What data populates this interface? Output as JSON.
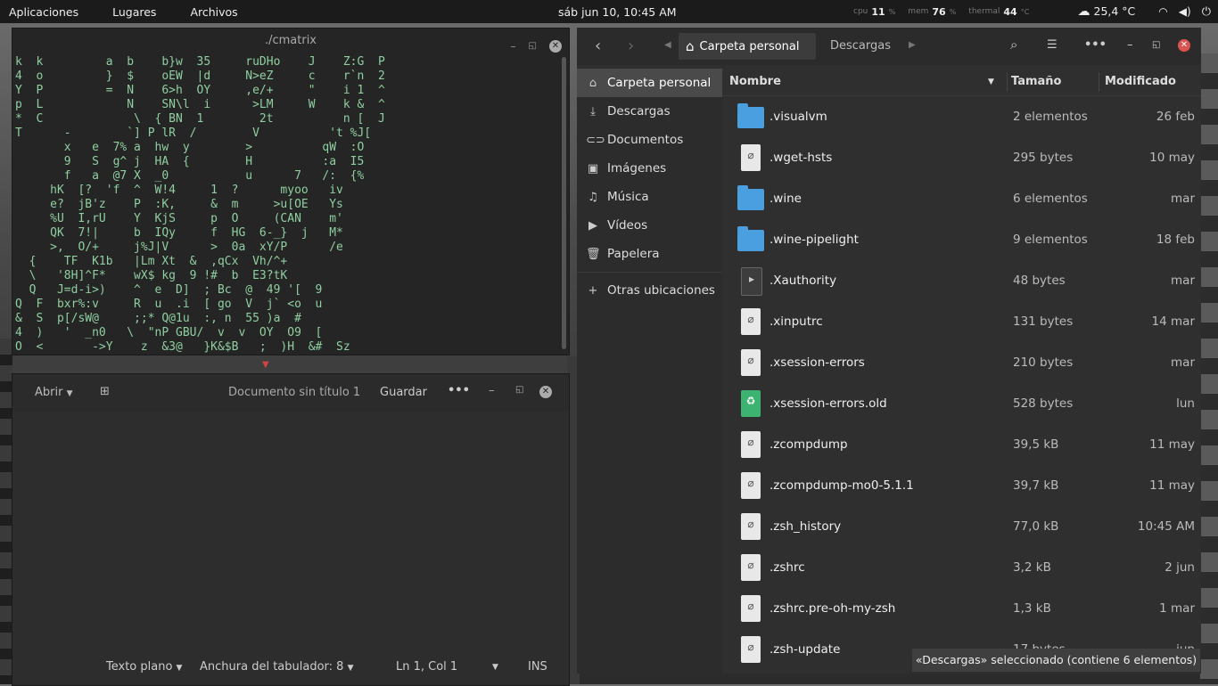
{
  "topbar": {
    "apps": "Aplicaciones",
    "places": "Lugares",
    "files": "Archivos",
    "clock": "sáb jun 10, 10:45 AM",
    "cpu_label": "cpu",
    "cpu_val": "11",
    "mem_label": "mem",
    "mem_val": "76",
    "thermal_label": "thermal",
    "thermal_val": "44",
    "pct": "%",
    "deg": "°C",
    "weather": "25,4 °C"
  },
  "terminal": {
    "title": "./cmatrix",
    "matrix": "k  k         a  b    b}w  35     ruDHo    J    Z:G  P\n4  o         }  $    oEW  |d     N>eZ     c    r`n  2\nY  P         =  N    6>h  OY     ,e/+     \"    i 1  ^\np  L            N    SN\\l  i      >LM     W    k &  ^\n*  C             \\  { BN  1        2t          n [  J\nT      -        `] P lR  /        V          't %J[\n       x   e  7% a  hw  y        >          qW  :O\n       9   S  g^ j  HA  {        H          :a  I5\n       f   a  @7 X  _0           u      7   /:  {%\n     hK  [?  'f  ^  W!4     1  ?      myoo   iv\n     e?  jB'z    P  :K,     &  m     >u[OE   Ys\n     %U  I,rU    Y  KjS     p  O     (CAN    m'\n     QK  7!|     b  IQy     f  HG  6-_}  j   M*\n     >,  O/+     j%J|V      >  0a  xY/P      /e\n  {    TF  K1b   |Lm Xt  &  ,qCx  Vh/^+\n  \\   '8H]^F*    wX$ kg  9 !#  b  E3?tK\n  Q   J=d-i>)    ^  e  D]  ; Bc  @  49 '[  9\nQ  F  bxr%:v     R  u  .i  [ go  V  j` <o  u\n&  S  p[/sW@     ;;* Q@1u  :, n  55 )a  #\n4  )   '  _n0   \\  \"nP GBU/  v  v  OY  O9  [\nO  <       ->Y    z  &3@   }K&$B   ;  )H  &#  Sz"
  },
  "editor": {
    "open": "Abrir",
    "title": "Documento sin título 1",
    "save": "Guardar",
    "syntax": "Texto plano",
    "tab_width": "Anchura del tabulador: 8",
    "position": "Ln 1, Col 1",
    "mode": "INS"
  },
  "files": {
    "breadcrumb_home": "Carpeta personal",
    "breadcrumb_next": "Descargas",
    "sidebar": [
      {
        "label": "Carpeta personal",
        "icon": "home-icon"
      },
      {
        "label": "Descargas",
        "icon": "download-icon"
      },
      {
        "label": "Documentos",
        "icon": "documents-icon"
      },
      {
        "label": "Imágenes",
        "icon": "pictures-icon"
      },
      {
        "label": "Música",
        "icon": "music-icon"
      },
      {
        "label": "Vídeos",
        "icon": "videos-icon"
      },
      {
        "label": "Papelera",
        "icon": "trash-icon"
      },
      {
        "label": "Otras ubicaciones",
        "icon": "plus-icon"
      }
    ],
    "columns": {
      "name": "Nombre",
      "size": "Tamaño",
      "modified": "Modificado"
    },
    "rows": [
      {
        "name": ".visualvm",
        "size": "2 elementos",
        "mod": "26 feb",
        "type": "folder"
      },
      {
        "name": ".wget-hsts",
        "size": "295 bytes",
        "mod": "10 may",
        "type": "text"
      },
      {
        "name": ".wine",
        "size": "6 elementos",
        "mod": "mar",
        "type": "folder"
      },
      {
        "name": ".wine-pipelight",
        "size": "9 elementos",
        "mod": "18 feb",
        "type": "folder"
      },
      {
        "name": ".Xauthority",
        "size": "48 bytes",
        "mod": "mar",
        "type": "exec"
      },
      {
        "name": ".xinputrc",
        "size": "131 bytes",
        "mod": "14 mar",
        "type": "text"
      },
      {
        "name": ".xsession-errors",
        "size": "210 bytes",
        "mod": "mar",
        "type": "text"
      },
      {
        "name": ".xsession-errors.old",
        "size": "528 bytes",
        "mod": "lun",
        "type": "trash"
      },
      {
        "name": ".zcompdump",
        "size": "39,5 kB",
        "mod": "11 may",
        "type": "text"
      },
      {
        "name": ".zcompdump-mo0-5.1.1",
        "size": "39,7 kB",
        "mod": "11 may",
        "type": "text"
      },
      {
        "name": ".zsh_history",
        "size": "77,0 kB",
        "mod": "10:45 AM",
        "type": "text"
      },
      {
        "name": ".zshrc",
        "size": "3,2 kB",
        "mod": "2 jun",
        "type": "text"
      },
      {
        "name": ".zshrc.pre-oh-my-zsh",
        "size": "1,3 kB",
        "mod": "1 mar",
        "type": "text"
      },
      {
        "name": ".zsh-update",
        "size": "17 bytes",
        "mod": "jun",
        "type": "text"
      }
    ],
    "toast": "«Descargas» seleccionado  (contiene 6 elementos)"
  }
}
